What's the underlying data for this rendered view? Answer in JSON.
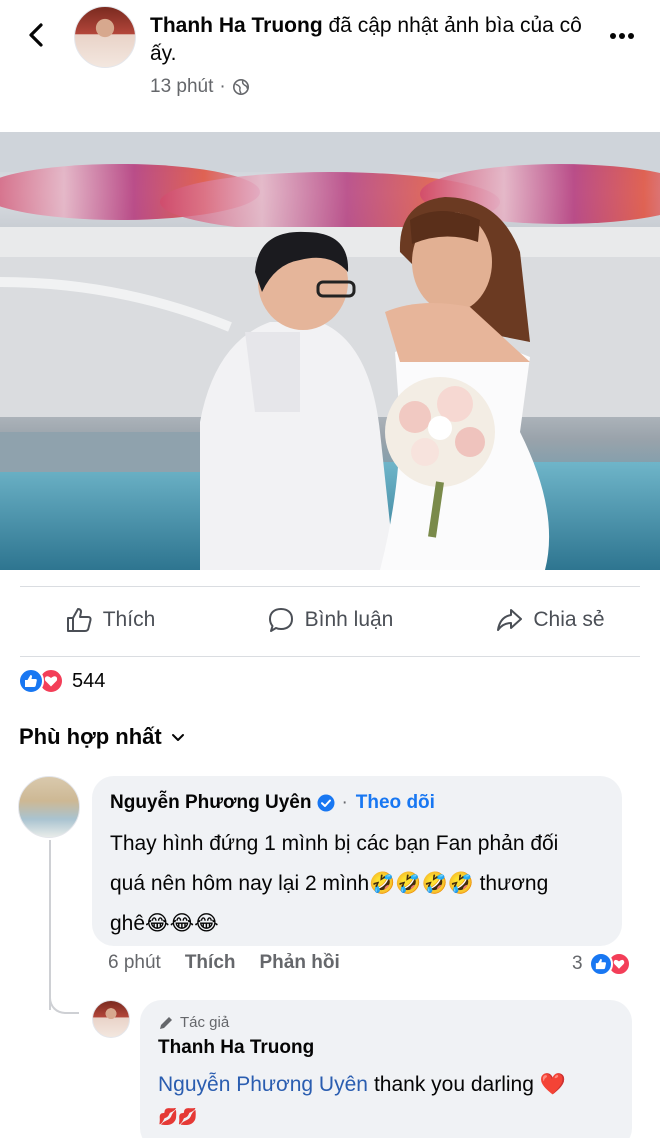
{
  "header": {
    "author": "Thanh Ha Truong",
    "action_text": "đã cập nhật ảnh bìa của cô ấy.",
    "time": "13 phút",
    "separator": "·",
    "privacy_icon": "globe-icon",
    "back_icon": "chevron-left-icon",
    "more_icon": "more-dots-icon"
  },
  "actions": {
    "like_label": "Thích",
    "comment_label": "Bình luận",
    "share_label": "Chia sẻ"
  },
  "reactions": {
    "count": "544",
    "types": [
      "like",
      "love"
    ]
  },
  "sort": {
    "label": "Phù hợp nhất"
  },
  "comment": {
    "author": "Nguyễn Phương Uyên",
    "verified": true,
    "follow_label": "Theo dõi",
    "separator": "·",
    "text_line1": "Thay hình đứng 1 mình bị các bạn Fan phản đối",
    "text_line2": "quá nên hôm nay lại 2 mình🤣🤣🤣🤣 thương",
    "text_line3": "ghê😂😂😂",
    "time": "6 phút",
    "like_label": "Thích",
    "reply_label": "Phản hồi",
    "reaction_count": "3"
  },
  "reply": {
    "badge": "Tác giả",
    "author": "Thanh Ha Truong",
    "mention": "Nguyễn Phương Uyên",
    "text": "thank you darling",
    "heart": "❤️",
    "emoji_line": "💋💋"
  },
  "colors": {
    "accent": "#1877f2",
    "love": "#f33e58",
    "bubble": "#f0f2f5",
    "muted": "#65676b"
  }
}
